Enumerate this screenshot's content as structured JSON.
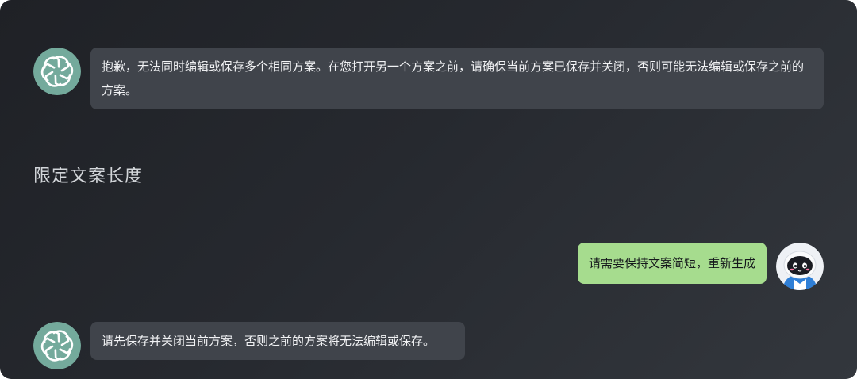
{
  "conversation": {
    "msg1": {
      "text": "抱歉，无法同时编辑或保存多个相同方案。在您打开另一个方案之前，请确保当前方案已保存并关闭，否则可能无法编辑或保存之前的方案。",
      "avatar_icon": "chatgpt-logo-icon"
    },
    "section_title": "限定文案长度",
    "msg2": {
      "text": "请需要保持文案简短，重新生成",
      "avatar_icon": "robot-avatar-icon"
    },
    "msg3": {
      "text": "请先保存并关闭当前方案，否则之前的方案将无法编辑或保存。",
      "avatar_icon": "chatgpt-logo-icon"
    }
  },
  "colors": {
    "ai_avatar_bg": "#74aa9c",
    "user_bubble": "#a6dc8e",
    "ai_bubble": "#40444b"
  }
}
